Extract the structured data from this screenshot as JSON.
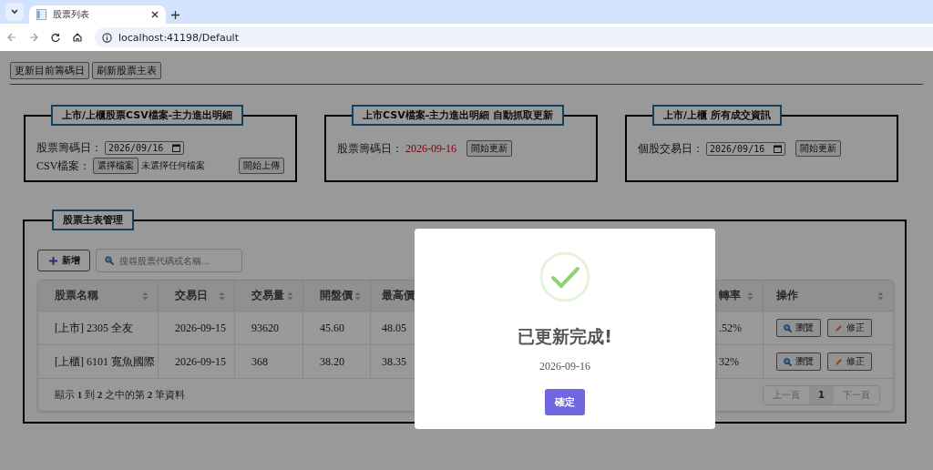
{
  "browser": {
    "tabs": [
      {
        "title": "股票列表",
        "selected": true
      }
    ],
    "url": "localhost:41198/Default"
  },
  "toolbar": [
    "更新目前籌碼日",
    "刷新股票主表"
  ],
  "panels": [
    {
      "legend": "上市/上櫃股票CSV檔案-主力進出明細",
      "fields": [
        {
          "kind": "date",
          "label": "股票籌碼日：",
          "value": "2026/09/16"
        },
        {
          "kind": "file",
          "label": "CSV檔案：",
          "button": "選擇檔案",
          "value": "未選擇任何檔案",
          "action": "開始上傳"
        }
      ]
    },
    {
      "legend": "上市CSV檔案-主力進出明細 自動抓取更新",
      "fields": [
        {
          "kind": "text",
          "label": "股票籌碼日：",
          "value": "2026-09-16",
          "action": "開始更新"
        }
      ]
    },
    {
      "legend": "上市/上櫃 所有成交資訊",
      "fields": [
        {
          "kind": "date",
          "label": "個股交易日：",
          "value": "2026/09/16",
          "action": "開始更新"
        }
      ]
    }
  ],
  "manager": {
    "legend": "股票主表管理",
    "add_button": "新增",
    "search": {
      "placeholder": "搜尋股票代碼或名稱..."
    },
    "table": {
      "columns": [
        {
          "label": "股票名稱",
          "sortable": true
        },
        {
          "label": "交易日",
          "sortable": true
        },
        {
          "label": "交易量",
          "sortable": true
        },
        {
          "label": "開盤價",
          "sortable": true
        },
        {
          "label": "最高價"
        },
        {
          "label": "轉率",
          "sortable": true
        },
        {
          "label": "操作",
          "sortable": true
        }
      ],
      "rows": [
        {
          "cells": [
            "[上市] 2305 全友",
            "2026-09-15",
            "93620",
            "45.60",
            "48.05",
            ".52%"
          ],
          "actions": [
            {
              "kind": "view",
              "label": "瀏覽"
            },
            {
              "kind": "edit",
              "label": "修正"
            }
          ]
        },
        {
          "cells": [
            "[上櫃] 6101 寬魚國際",
            "2026-09-15",
            "368",
            "38.20",
            "38.35",
            "32%"
          ],
          "actions": [
            {
              "kind": "view",
              "label": "瀏覽"
            },
            {
              "kind": "edit",
              "label": "修正"
            }
          ]
        }
      ]
    },
    "info": "顯示 **1** 到 **2** 之中的第 **2** 筆資料",
    "pager": {
      "prev": {
        "label": "上一頁",
        "disabled": true
      },
      "pages": [
        {
          "label": "1",
          "selected": true
        }
      ],
      "next": {
        "label": "下一頁",
        "disabled": true
      }
    }
  },
  "modal": {
    "kind": "success",
    "title": "已更新完成!",
    "text": "2026-09-16",
    "confirm": "確定"
  }
}
